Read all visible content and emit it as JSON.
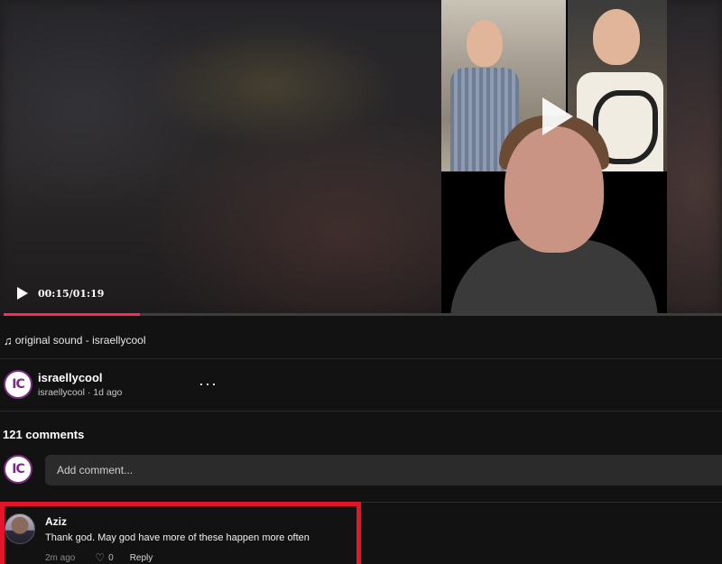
{
  "video": {
    "timestamp": "00:15/01:19",
    "progress_fraction": 0.19,
    "accent_color": "#fe2c55"
  },
  "sound": {
    "icon": "music-note-icon",
    "note_glyph": "♫",
    "label": "original sound - israellycool"
  },
  "author": {
    "avatar_text": "IC",
    "name": "israellycool",
    "meta": "israellycool · 1d ago",
    "more_label": "···"
  },
  "comments": {
    "count_label": "121 comments",
    "input_placeholder": "Add comment...",
    "self_avatar_text": "IC",
    "items": [
      {
        "name": "Aziz",
        "text": "Thank god. May god have more of these happen more often",
        "time": "2m ago",
        "likes": "0",
        "reply_label": "Reply"
      }
    ]
  },
  "highlight_color": "#e5142c"
}
